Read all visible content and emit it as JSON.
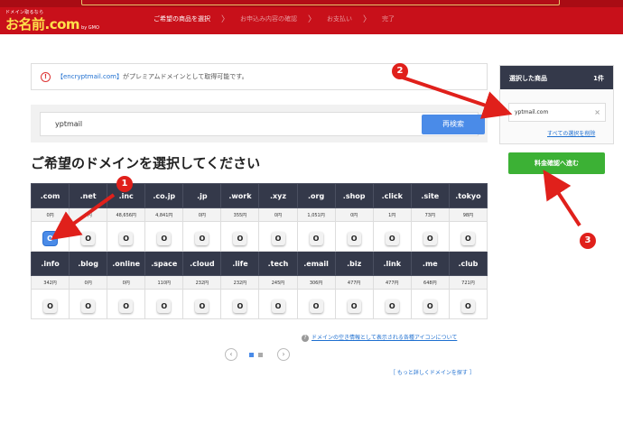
{
  "header": {
    "logo_tagline": "ドメイン取るなら",
    "logo_text": "お名前.com",
    "logo_sub": "by GMO",
    "steps": [
      "ご希望の商品を選択",
      "お申込み内容の確認",
      "お支払い",
      "完了"
    ],
    "step_sep": "〉"
  },
  "notice": {
    "icon": "!",
    "domain": "【encryptmail.com】",
    "message": "がプレミアムドメインとして取得可能です。"
  },
  "search": {
    "value": "yptmail",
    "button_label": "再検索"
  },
  "heading": "ご希望のドメインを選択してください",
  "rows": [
    {
      "tlds": [
        ".com",
        ".net",
        ".inc",
        ".co.jp",
        ".jp",
        ".work",
        ".xyz",
        ".org",
        ".shop",
        ".click",
        ".site",
        ".tokyo"
      ],
      "prices": [
        "0円",
        "0円",
        "48,656円",
        "4,841円",
        "0円",
        "355円",
        "0円",
        "1,051円",
        "0円",
        "1円",
        "73円",
        "98円"
      ],
      "selected": [
        true,
        false,
        false,
        false,
        false,
        false,
        false,
        false,
        false,
        false,
        false,
        false
      ]
    },
    {
      "tlds": [
        ".info",
        ".blog",
        ".online",
        ".space",
        ".cloud",
        ".life",
        ".tech",
        ".email",
        ".biz",
        ".link",
        ".me",
        ".club"
      ],
      "prices": [
        "342円",
        "0円",
        "0円",
        "110円",
        "232円",
        "232円",
        "245円",
        "306円",
        "477円",
        "477円",
        "648円",
        "721円"
      ],
      "selected": [
        false,
        false,
        false,
        false,
        false,
        false,
        false,
        false,
        false,
        false,
        false,
        false
      ]
    }
  ],
  "radio_mark": "O",
  "legend_icon": "?",
  "legend_link": "ドメインの空き情報として表示される各種アイコンについて",
  "pager": {
    "prev": "‹",
    "next": "›",
    "current_page": 1,
    "total_pages": 2
  },
  "more_link": "［ もっと詳しくドメインを探す ］",
  "cart": {
    "title": "選択した商品",
    "count": "1件",
    "item": "yptmail.com",
    "remove_icon": "×",
    "clear_link": "すべての選択を削除",
    "confirm_button": "料金確認へ進む"
  },
  "annotations": [
    "1",
    "2",
    "3"
  ],
  "colors": {
    "header_red": "#c8101a",
    "table_dark": "#34394a",
    "primary_blue": "#4a8be8",
    "confirm_green": "#3cb135",
    "annotation_red": "#e0201b"
  }
}
